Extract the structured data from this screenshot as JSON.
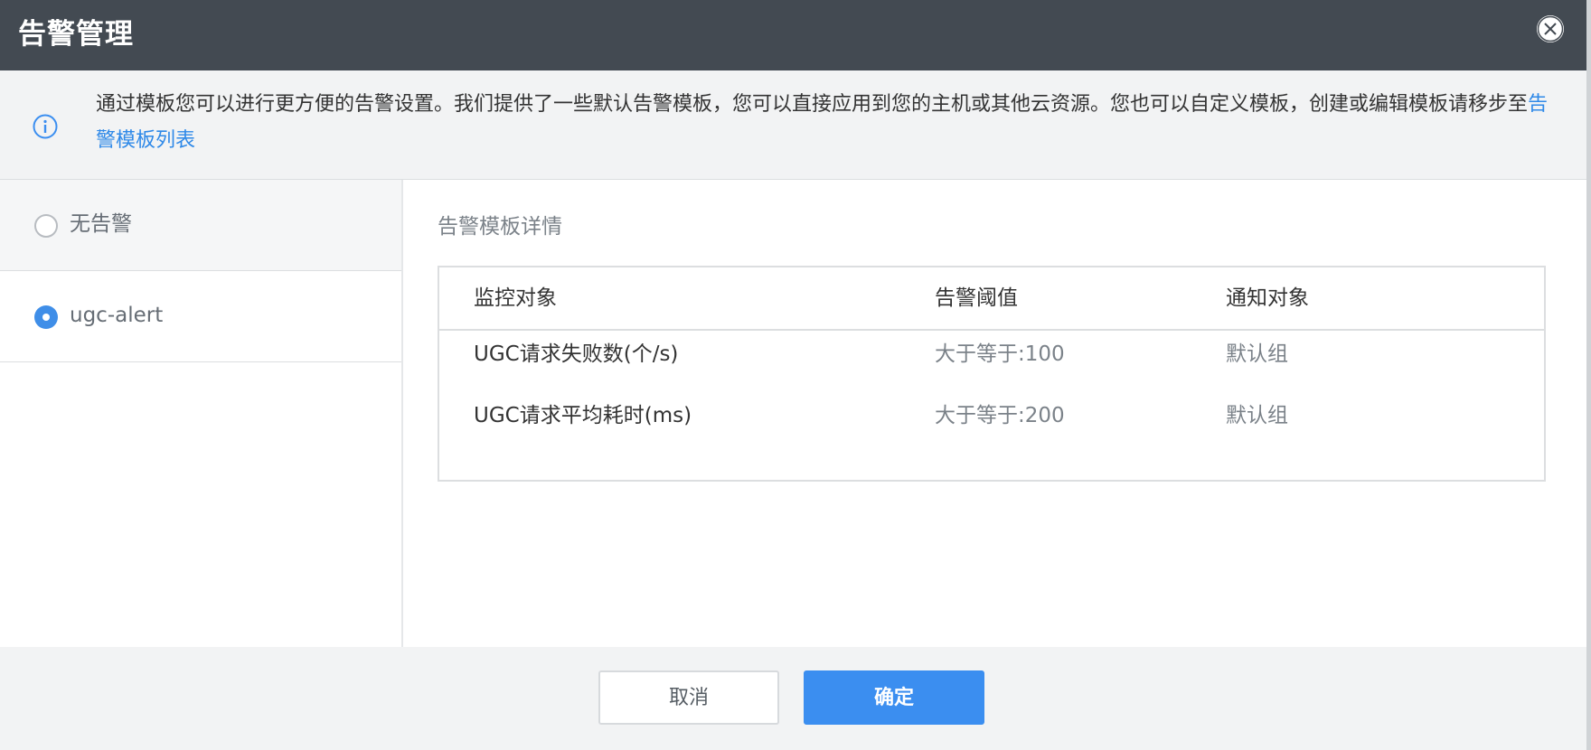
{
  "dialog": {
    "title": "告警管理",
    "close_icon": "close-circle-icon"
  },
  "notice": {
    "icon": "info-icon",
    "text": "通过模板您可以进行更方便的告警设置。我们提供了一些默认告警模板，您可以直接应用到您的主机或其他云资源。您也可以自定义模板，创建或编辑模板请移步至",
    "link": "告警模板列表"
  },
  "sidebar": {
    "items": [
      {
        "label": "无告警",
        "checked": false
      },
      {
        "label": "ugc-alert",
        "checked": true
      }
    ]
  },
  "detail": {
    "title": "告警模板详情",
    "columns": [
      "监控对象",
      "告警阈值",
      "通知对象"
    ],
    "rows": [
      {
        "object": "UGC请求失败数(个/s)",
        "threshold": "大于等于:100",
        "notify": "默认组"
      },
      {
        "object": "UGC请求平均耗时(ms)",
        "threshold": "大于等于:200",
        "notify": "默认组"
      }
    ]
  },
  "footer": {
    "cancel_label": "取消",
    "ok_label": "确定"
  },
  "colors": {
    "header_bg": "#434a52",
    "accent": "#3b8ef0",
    "link": "#2f89e8",
    "panel_bg": "#f2f3f4"
  }
}
